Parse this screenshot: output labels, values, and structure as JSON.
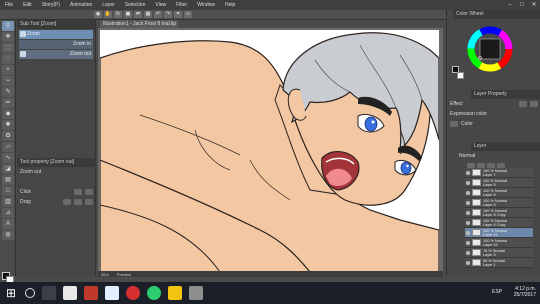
{
  "menu": [
    "File",
    "Edit",
    "Story(P)",
    "Animation",
    "Layer",
    "Selection",
    "View",
    "Filter",
    "Window",
    "Help"
  ],
  "window_controls": [
    "–",
    "□",
    "✕"
  ],
  "subtool": {
    "header": "Sub Tool [Zoom]",
    "items": [
      {
        "label": "Zoom",
        "right": ""
      },
      {
        "label": "",
        "right": "Zoom in"
      },
      {
        "label": "",
        "right": "Zoom out"
      }
    ]
  },
  "tool_property": {
    "header": "Tool property [Zoom out]",
    "title": "Zoom out",
    "rows": [
      "Click",
      "Drag"
    ]
  },
  "document_tab": "Illustration1 - Jack Frost 8 trial.lip (67...",
  "status": {
    "zoom": "38.6",
    "label": "Preview"
  },
  "color_panel": {
    "header": "Color Wheel"
  },
  "layer_property": {
    "header": "Layer Property",
    "effect": "Effect",
    "expression_label": "Expression color",
    "expression_value": "Color"
  },
  "layer_panel": {
    "header": "Layer",
    "blend": "Normal",
    "layers": [
      {
        "line1": "100 % Normal",
        "line2": "Layer 7"
      },
      {
        "line1": "100 % Normal",
        "line2": "Layer 5"
      },
      {
        "line1": "100 % Normal",
        "line2": "Layer 8"
      },
      {
        "line1": "100 % Normal",
        "line2": "Layer 9"
      },
      {
        "line1": "100 % Normal",
        "line2": "Layer 8 Copy"
      },
      {
        "line1": "100 % Normal",
        "line2": "Layer 6 Copy"
      },
      {
        "line1": "100 % Normal",
        "line2": "Layer 11"
      },
      {
        "line1": "100 % Normal",
        "line2": "Layer 10"
      },
      {
        "line1": "78 % Normal",
        "line2": "Layer 3"
      },
      {
        "line1": "55 % Normal",
        "line2": "Layer 1"
      }
    ]
  },
  "taskbar": {
    "time": "4:12 p.m.",
    "date": "25/7/2017",
    "lang": "ESP"
  },
  "colors": {
    "skin": "#f2c7a2",
    "hair": "#c9ccd0",
    "eye": "#3a6fe0",
    "mouth": "#a3343a",
    "tongue": "#f08a8e",
    "selected_layer": "#6d88aa"
  }
}
